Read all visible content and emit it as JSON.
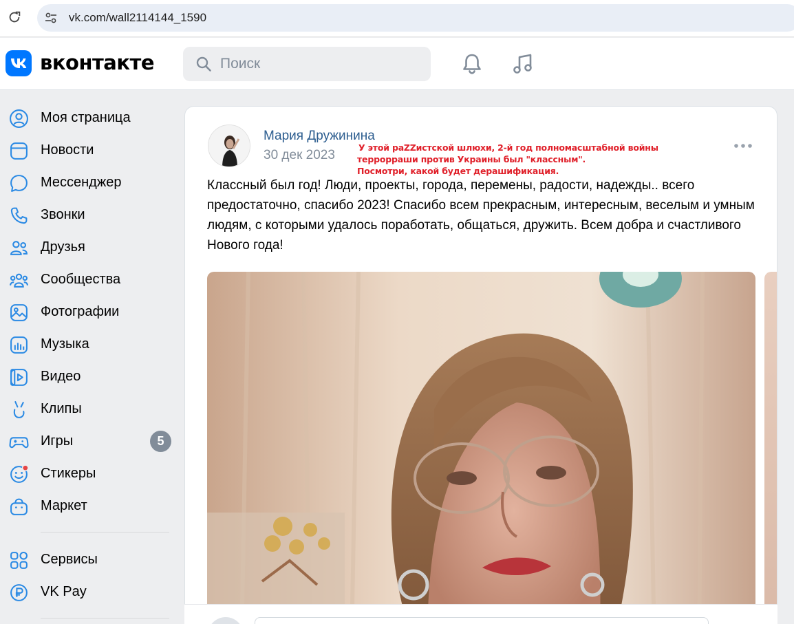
{
  "browser": {
    "url": "vk.com/wall2114144_1590"
  },
  "header": {
    "logo_text": "вконтакте",
    "search_placeholder": "Поиск"
  },
  "sidebar": {
    "items": [
      {
        "label": "Моя страница",
        "icon": "user-circle-icon"
      },
      {
        "label": "Новости",
        "icon": "newsfeed-icon"
      },
      {
        "label": "Мессенджер",
        "icon": "message-icon"
      },
      {
        "label": "Звонки",
        "icon": "phone-icon"
      },
      {
        "label": "Друзья",
        "icon": "friends-icon"
      },
      {
        "label": "Сообщества",
        "icon": "communities-icon"
      },
      {
        "label": "Фотографии",
        "icon": "photos-icon"
      },
      {
        "label": "Музыка",
        "icon": "music-icon"
      },
      {
        "label": "Видео",
        "icon": "video-icon"
      },
      {
        "label": "Клипы",
        "icon": "clips-icon"
      },
      {
        "label": "Игры",
        "icon": "games-icon",
        "badge": "5"
      },
      {
        "label": "Стикеры",
        "icon": "stickers-icon"
      },
      {
        "label": "Маркет",
        "icon": "market-icon"
      }
    ],
    "extra_items": [
      {
        "label": "Сервисы",
        "icon": "services-icon"
      },
      {
        "label": "VK Pay",
        "icon": "vkpay-icon"
      }
    ]
  },
  "post": {
    "author": "Мария Дружинина",
    "date": "30 дек 2023",
    "annotation_lines": [
      "У этой раZZистской шлюхи, 2-й год полномасштабной войны",
      "террорраши против Украины был \"классным\".",
      "Посмотри, какой будет дерашификация."
    ],
    "text": "Классный был год! Люди, проекты, города, перемены, радости, надежды.. всего предостаточно, спасибо 2023! Спасибо всем прекрасным, интересным, веселым и умным людям, с которыми удалось поработать, общаться, дружить. Всем добра и счастливого Нового года!"
  },
  "colors": {
    "accent": "#0077ff",
    "author": "#2c5d8f",
    "annotation": "#e0202a",
    "badge": "#818c99"
  }
}
